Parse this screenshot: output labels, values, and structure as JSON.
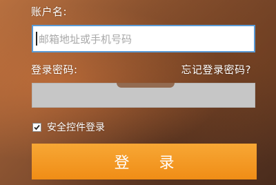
{
  "form": {
    "account_label": "账户名:",
    "account_placeholder": "邮箱地址或手机号码",
    "password_label": "登录密码:",
    "forgot_password_link": "忘记登录密码?",
    "secure_control_label": "安全控件登录",
    "secure_control_checked": true,
    "login_button_label": "登 录"
  },
  "colors": {
    "login_button": "#f29a20",
    "input_focus_border": "#5b9bd5",
    "password_field_bg": "#c6c6c6"
  }
}
